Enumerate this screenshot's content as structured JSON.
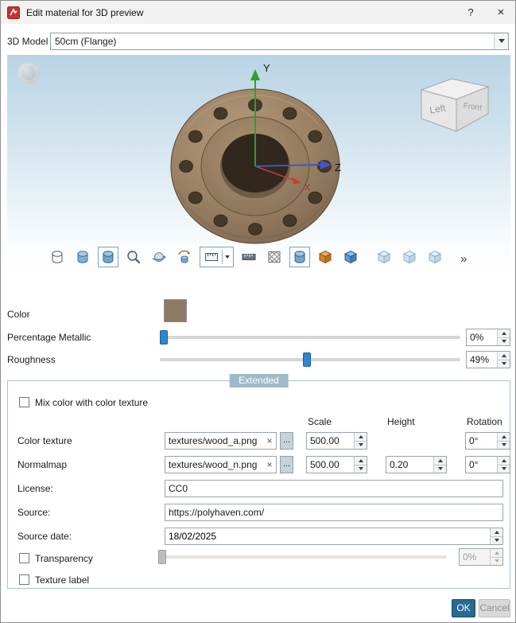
{
  "window": {
    "title": "Edit material for 3D preview",
    "help_icon": "?",
    "close_icon": "×"
  },
  "model": {
    "label": "3D Model",
    "selected": "50cm (Flange)"
  },
  "viewport": {
    "axes": {
      "x": "X",
      "y": "Y",
      "z": "Z"
    },
    "nav_cube": {
      "left_face": "Left",
      "front_face": "Front"
    },
    "toolbar": {
      "overflow_icon": "»",
      "icons": [
        "cylinder-wireframe",
        "cylinder-shaded",
        "cylinder-textured",
        "zoom",
        "orbit",
        "rotate-model",
        "screenshot-menu",
        "ruler",
        "grid",
        "cylinder-ground",
        "cube-orange",
        "cube-blue",
        "cube-pale-a",
        "cube-pale-b",
        "cube-pale-c"
      ]
    }
  },
  "controls": {
    "color_label": "Color",
    "color_swatch_hex": "#8d7a64",
    "metallic_label": "Percentage Metallic",
    "metallic_value": "0%",
    "roughness_label": "Roughness",
    "roughness_value": "49%"
  },
  "sliders": {
    "metallic": 0,
    "roughness": 49,
    "transparency": 0
  },
  "extended": {
    "group_title": "Extended",
    "mix_label": "Mix color with color texture",
    "columns": {
      "scale": "Scale",
      "height": "Height",
      "rotation": "Rotation"
    },
    "color_texture": {
      "label": "Color texture",
      "file": "textures/wood_a.png",
      "clear_icon": "×",
      "browse_label": "...",
      "scale": "500.00",
      "rotation": "0°"
    },
    "normalmap": {
      "label": "Normalmap",
      "file": "textures/wood_n.png",
      "clear_icon": "×",
      "browse_label": "...",
      "scale": "500.00",
      "height": "0.20",
      "rotation": "0°"
    },
    "license": {
      "label": "License:",
      "value": "CC0"
    },
    "source": {
      "label": "Source:",
      "value": "https://polyhaven.com/"
    },
    "source_date": {
      "label": "Source date:",
      "value": "18/02/2025"
    },
    "transparency": {
      "label": "Transparency",
      "value": "0%"
    },
    "texture_label": {
      "label": "Texture label"
    }
  },
  "footer": {
    "ok": "OK",
    "cancel": "Cancel"
  }
}
